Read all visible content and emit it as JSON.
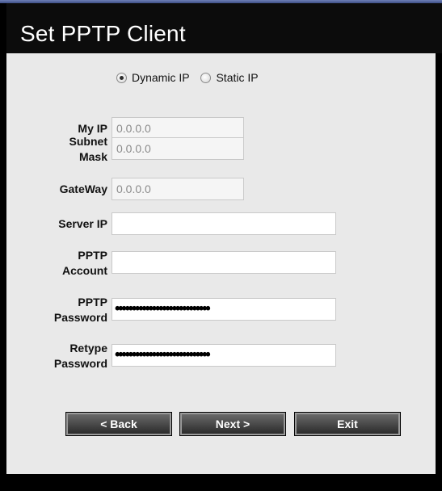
{
  "title": "Set PPTP Client",
  "ip_mode": {
    "options": [
      "Dynamic IP",
      "Static IP"
    ],
    "selected": "Dynamic IP"
  },
  "fields": {
    "my_ip": {
      "label": "My IP",
      "value": "0.0.0.0"
    },
    "subnet_mask": {
      "label_line1": "Subnet",
      "label_line2": "Mask",
      "value": "0.0.0.0"
    },
    "gateway": {
      "label": "GateWay",
      "value": "0.0.0.0"
    },
    "server_ip": {
      "label": "Server IP",
      "value": ""
    },
    "pptp_account": {
      "label_line1": "PPTP",
      "label_line2": "Account",
      "value": ""
    },
    "pptp_password": {
      "label_line1": "PPTP",
      "label_line2": "Password",
      "value": "••••••••••••••••••••••••••••"
    },
    "retype_password": {
      "label_line1": "Retype",
      "label_line2": "Password",
      "value": "••••••••••••••••••••••••••••"
    }
  },
  "buttons": {
    "back": "< Back",
    "next": "Next >",
    "exit": "Exit"
  },
  "colors": {
    "background": "#000000",
    "panel": "#e9e9e9",
    "title_text": "#ffffff"
  }
}
